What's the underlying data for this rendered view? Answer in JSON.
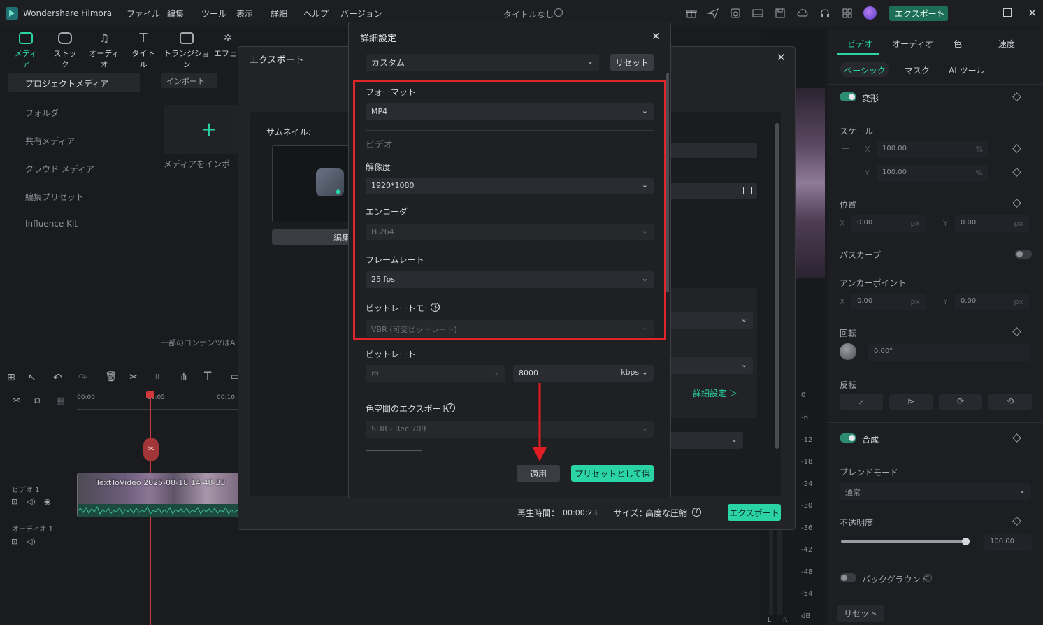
{
  "titlebar": {
    "app_name": "Wondershare Filmora",
    "menu": [
      "ファイル",
      "編集",
      "ツール",
      "表示",
      "詳細",
      "ヘルプ",
      "バージョン"
    ],
    "project_title": "タイトルなし",
    "export_button": "エクスポート"
  },
  "media_tabs": [
    "メディア",
    "ストック",
    "オーディオ",
    "タイトル",
    "トランジション",
    "エフェク"
  ],
  "left_tree": {
    "project_media": "プロジェクトメディア",
    "folder": "フォルダ",
    "shared_media": "共有メディア",
    "cloud_media": "クラウド メディア",
    "edit_preset": "編集プリセット",
    "influence_kit": "Influence Kit"
  },
  "media_area": {
    "import_button": "インポート",
    "import_hint": "メディアをインポー",
    "notice": "一部のコンテンツはA"
  },
  "timeline": {
    "times": [
      "00:00",
      "00:05",
      "00:10"
    ],
    "video_track": "ビデオ 1",
    "audio_track": "オーディオ 1",
    "clip_name": "TextToVideo 2025-08-18 14-48-33",
    "meter_scale": [
      "0",
      "-6",
      "-12",
      "-18",
      "-24",
      "-30",
      "-36",
      "-42",
      "-48",
      "-54",
      "dB"
    ],
    "meter_channels": [
      "L",
      "R"
    ]
  },
  "right_panel": {
    "tabs": [
      "ビデオ",
      "オーディオ",
      "色",
      "速度"
    ],
    "subtabs": [
      "ベーシック",
      "マスク",
      "AI ツール"
    ],
    "transform": "変形",
    "scale": "スケール",
    "scale_x": "100.00",
    "scale_y": "100.00",
    "percent": "%",
    "position": "位置",
    "pos_x": "0.00",
    "pos_y": "0.00",
    "px": "px",
    "path_curve": "パスカーブ",
    "anchor": "アンカーポイント",
    "anchor_x": "0.00",
    "anchor_y": "0.00",
    "rotation": "回転",
    "rotation_value": "0.00°",
    "flip": "反転",
    "composite": "合成",
    "blend_mode": "ブレンドモード",
    "blend_value": "通常",
    "opacity": "不透明度",
    "opacity_value": "100.00",
    "opacity_level": 1.0,
    "background": "バックグラウンド",
    "reset": "リセット",
    "x": "X",
    "y": "Y"
  },
  "export_dialog": {
    "title": "エクスポート",
    "thumbnail_label": "サムネイル:",
    "edit_button": "編集",
    "advanced_link": "詳細設定 ＞",
    "duration_label": "再生時間：",
    "duration_value": "00:00:23",
    "size_label": "サイズ：",
    "size_value": "高度な圧縮",
    "export_button": "エクスポート"
  },
  "settings_dialog": {
    "title": "詳細設定",
    "preset": "カスタム",
    "reset_button": "リセット",
    "format_label": "フォーマット",
    "format_value": "MP4",
    "video_section": "ビデオ",
    "resolution_label": "解像度",
    "resolution_value": "1920*1080",
    "encoder_label": "エンコーダ",
    "encoder_value": "H.264",
    "framerate_label": "フレームレート",
    "framerate_value": "25 fps",
    "bitrate_mode_label": "ビットレートモード",
    "bitrate_mode_value": "VBR (可変ビットレート)",
    "bitrate_label": "ビットレート",
    "bitrate_quality": "中",
    "bitrate_value": "8000",
    "bitrate_unit": "kbps",
    "color_space_label": "色空間のエクスポート",
    "color_space_value": "SDR - Rec.709",
    "apply_button": "適用",
    "save_preset_button": "プリセットとして保存"
  },
  "colors": {
    "accent": "#2ad4a5",
    "highlight": "#e0262b",
    "arrow": "#e11d24"
  }
}
